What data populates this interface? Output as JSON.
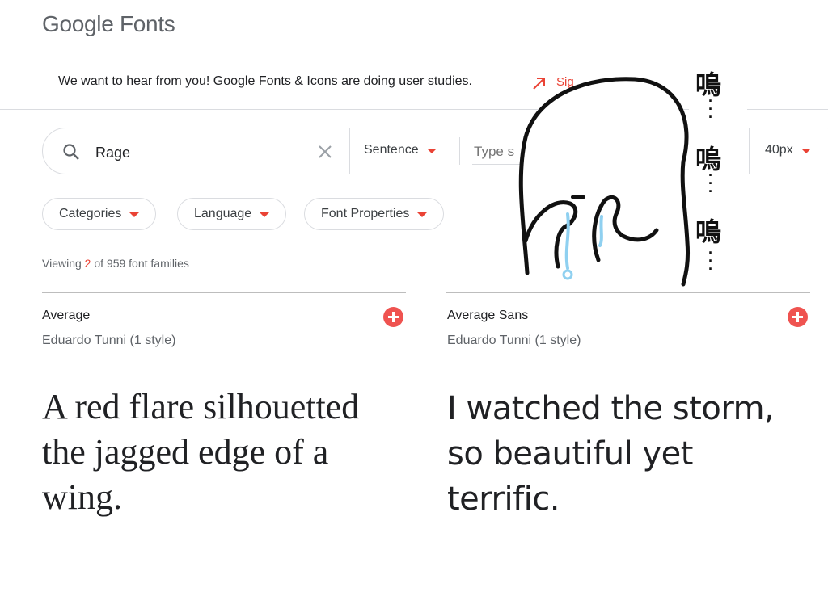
{
  "header": {
    "logo": "Google Fonts"
  },
  "banner": {
    "message": "We want to hear from you! Google Fonts & Icons are doing user studies.",
    "link_label": "Sig"
  },
  "search": {
    "query": "Rage",
    "preview_mode": "Sentence",
    "type_placeholder": "Type s",
    "size": "40px"
  },
  "filters": {
    "categories": "Categories",
    "language": "Language",
    "font_properties": "Font Properties"
  },
  "results": {
    "prefix": "Viewing ",
    "count": "2",
    "suffix": " of 959 font families"
  },
  "fonts": [
    {
      "name": "Average",
      "author": "Eduardo Tunni (1 style)",
      "sample": "A red flare silhouetted the jagged edge of a wing."
    },
    {
      "name": "Average Sans",
      "author": "Eduardo Tunni (1 style)",
      "sample": "I watched the storm, so beautiful yet terrific."
    }
  ],
  "sticker": {
    "chars": [
      "嗚",
      "嗚",
      "嗚"
    ]
  },
  "colors": {
    "accent": "#ea4335",
    "add_button": "#ef5350",
    "tears": "#8fd0f0"
  }
}
